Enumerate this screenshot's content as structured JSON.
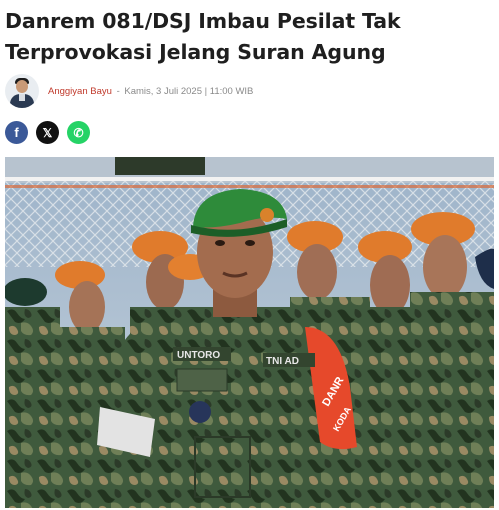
{
  "article": {
    "title": "Danrem 081/DSJ Imbau Pesilat Tak Terprovokasi Jelang Suran Agung",
    "author": "Anggiyan Bayu",
    "separator": "-",
    "date": "Kamis, 3 Juli 2025 | 11:00 WIB"
  },
  "share": [
    {
      "network": "facebook",
      "glyph": "f",
      "color": "#3b5998"
    },
    {
      "network": "x",
      "glyph": "𝕏",
      "color": "#111111"
    },
    {
      "network": "whatsapp",
      "glyph": "✆",
      "color": "#25d366"
    }
  ],
  "photo": {
    "name_tapes": [
      "UNTORO",
      "TNI AD"
    ],
    "badge_text": [
      "DANR",
      "KODA"
    ]
  }
}
